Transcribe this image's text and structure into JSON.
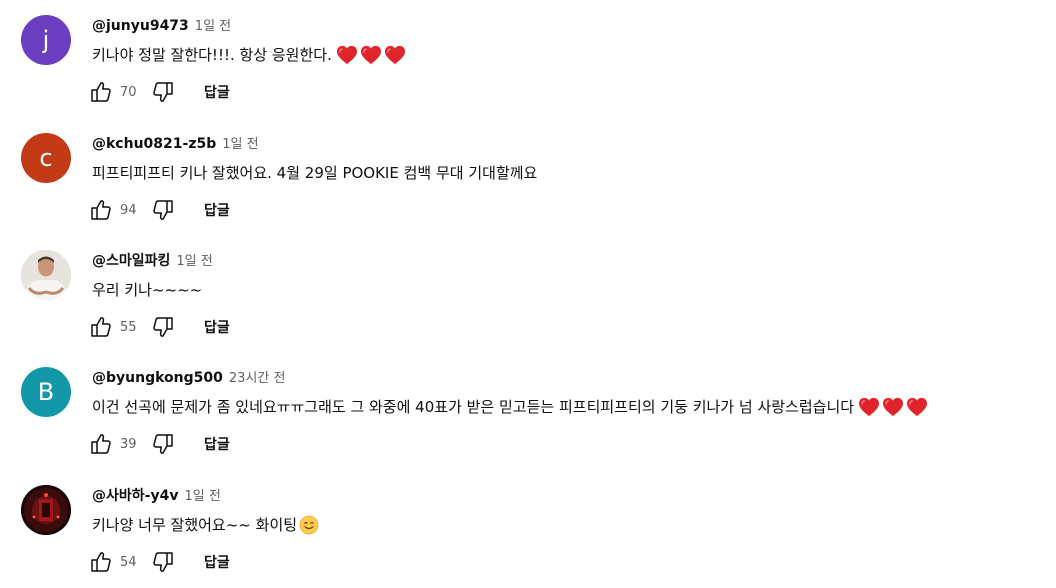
{
  "comments": [
    {
      "author": "@junyu9473",
      "time": "1일 전",
      "text": "키나야 정말 잘한다!!!. 항상 응원한다.",
      "suffix": "hearts",
      "likes": "70",
      "reply": "답글",
      "avatar": {
        "letter": "j",
        "color": "#6a3ebf"
      }
    },
    {
      "author": "@kchu0821-z5b",
      "time": "1일 전",
      "text": "피프티피프티 키나 잘했어요. 4월 29일 POOKIE 컴백 무대 기대할께요",
      "suffix": "none",
      "likes": "94",
      "reply": "답글",
      "avatar": {
        "letter": "c",
        "color": "#c23b16"
      }
    },
    {
      "author": "@스마일파킹",
      "time": "1일 전",
      "text": "우리 키나~~~~",
      "suffix": "none",
      "likes": "55",
      "reply": "답글",
      "avatar": {
        "letter": "",
        "color": "#d9d6d2",
        "kind": "photo-person"
      }
    },
    {
      "author": "@byungkong500",
      "time": "23시간 전",
      "text": "이건 선곡에 문제가 좀 있네요ㅠㅠ그래도 그 와중에 40표가 받은  믿고듣는  피프티피프티의 기둥 키나가 넘 사랑스럽습니다",
      "suffix": "hearts",
      "likes": "39",
      "reply": "답글",
      "avatar": {
        "letter": "B",
        "color": "#1297a9"
      }
    },
    {
      "author": "@사바하-y4v",
      "time": "1일 전",
      "text": "키나양 너무 잘했어요~~ 화이팅",
      "suffix": "smile",
      "likes": "54",
      "reply": "답글",
      "avatar": {
        "letter": "",
        "color": "#2a0a0a",
        "kind": "photo-dark"
      }
    }
  ],
  "icons": {
    "like": "thumbs-up-icon",
    "dislike": "thumbs-down-icon",
    "heart": "red-heart-emoji",
    "smile": "smiling-face-emoji"
  },
  "colors": {
    "heart": "#e0242c",
    "meta": "#606060",
    "text": "#0f0f0f"
  }
}
